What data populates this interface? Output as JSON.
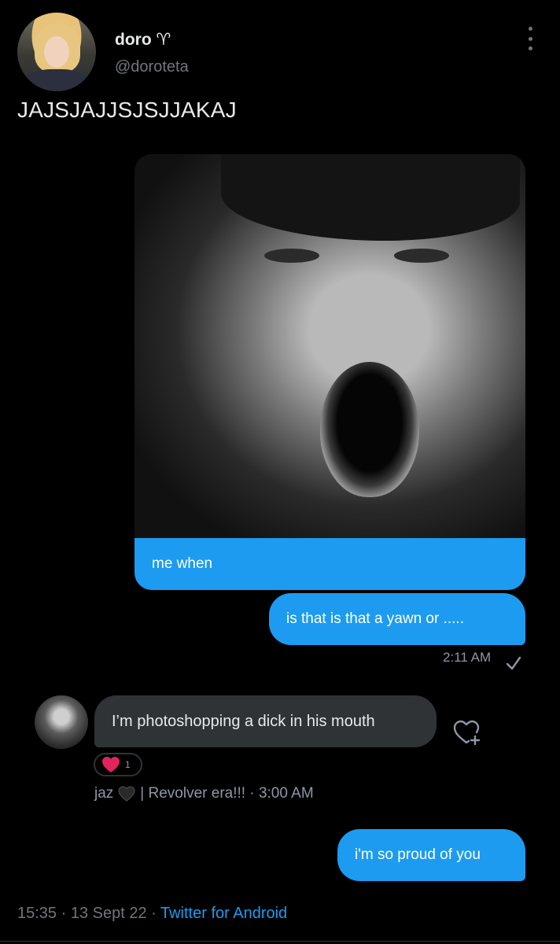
{
  "header": {
    "display_name": "doro ♈",
    "handle": "@doroteta"
  },
  "tweet_text": "JAJSJAJJSJSJJAKAJ",
  "messages": {
    "caption": "me when",
    "outgoing_1": "is that is that a yawn or .....",
    "outgoing_1_time": "2:11 AM",
    "incoming_1": "I’m photoshopping a dick in his mouth",
    "incoming_reaction_count": "1",
    "incoming_sender": "jaz",
    "incoming_sender_suffix": "| Revolver era!!! · 3:00 AM",
    "outgoing_2": "i'm so proud of you"
  },
  "footer": {
    "time_date": "15:35 · 13 Sept 22 · ",
    "client": "Twitter for Android"
  },
  "colors": {
    "accent": "#1d9bf0",
    "background": "#000000",
    "incoming_bubble": "#2f3336",
    "reaction": "#e0245e"
  },
  "icons": {
    "more": "more-vertical-icon",
    "check": "check-icon",
    "add_reaction": "heart-plus-icon",
    "reaction": "red-heart-emoji",
    "sender_badge": "black-heart-emoji"
  }
}
